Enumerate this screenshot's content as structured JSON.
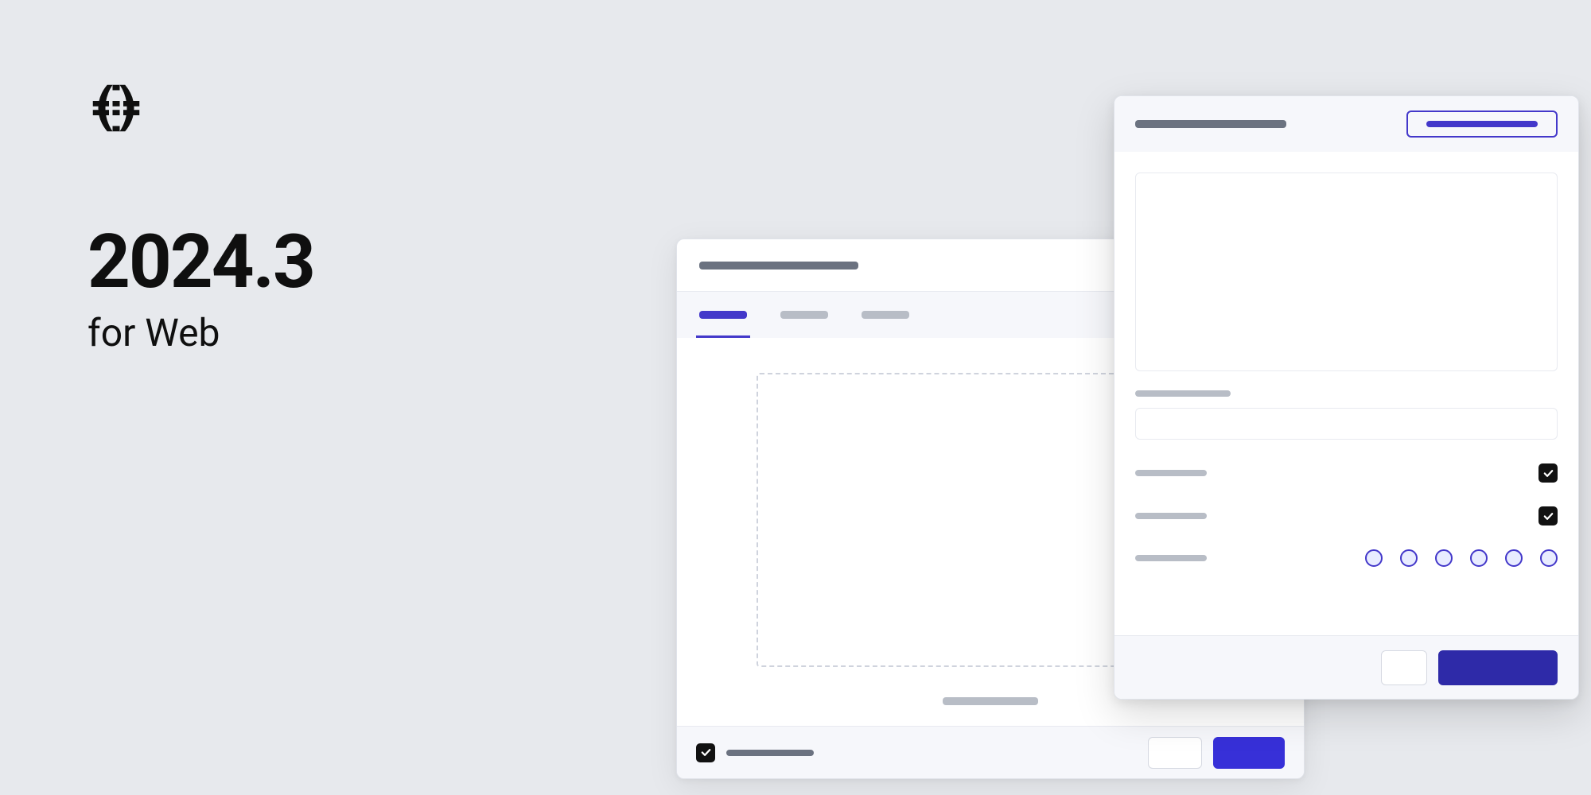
{
  "hero": {
    "version": "2024.3",
    "subtitle": "for Web"
  },
  "back_window": {
    "title_placeholder": "",
    "tabs": [
      {
        "label": "",
        "active": true
      },
      {
        "label": "",
        "active": false
      },
      {
        "label": "",
        "active": false
      }
    ],
    "dropzone_caption": "",
    "footer_checkbox_checked": true,
    "footer_label": "",
    "cancel_label": "",
    "confirm_label": ""
  },
  "front_window": {
    "title_placeholder": "",
    "badge_label": "",
    "preview_label": "",
    "field_label": "",
    "field_value": "",
    "options": [
      {
        "label": "",
        "checked": true
      },
      {
        "label": "",
        "checked": true
      }
    ],
    "color_label": "",
    "color_options": [
      "",
      "",
      "",
      "",
      "",
      ""
    ],
    "cancel_label": "",
    "confirm_label": ""
  },
  "colors": {
    "accent": "#4338ca",
    "accent_dark": "#2e2aa8",
    "bg": "#e7e9ed"
  }
}
